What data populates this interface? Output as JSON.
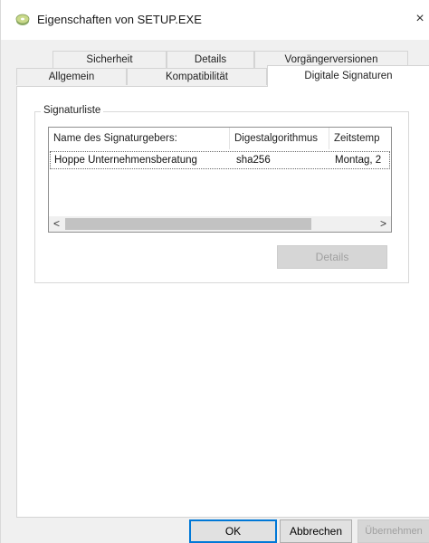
{
  "window": {
    "title": "Eigenschaften von SETUP.EXE",
    "icon": "setup-disc-icon",
    "close_glyph": "×"
  },
  "tabs": {
    "row1": [
      {
        "label": "Sicherheit"
      },
      {
        "label": "Details"
      },
      {
        "label": "Vorgängerversionen"
      }
    ],
    "row2": [
      {
        "label": "Allgemein"
      },
      {
        "label": "Kompatibilität"
      },
      {
        "label": "Digitale Signaturen",
        "active": true
      }
    ]
  },
  "signature_group": {
    "label": "Signaturliste",
    "columns": [
      "Name des Signaturgebers:",
      "Digestalgorithmus",
      "Zeitstemp"
    ],
    "rows": [
      [
        "Hoppe Unternehmensberatung",
        "sha256",
        "Montag, 2"
      ]
    ],
    "scroll_left": "<",
    "scroll_right": ">",
    "details_button": "Details"
  },
  "buttons": {
    "ok": "OK",
    "cancel": "Abbrechen",
    "apply": "Übernehmen"
  }
}
